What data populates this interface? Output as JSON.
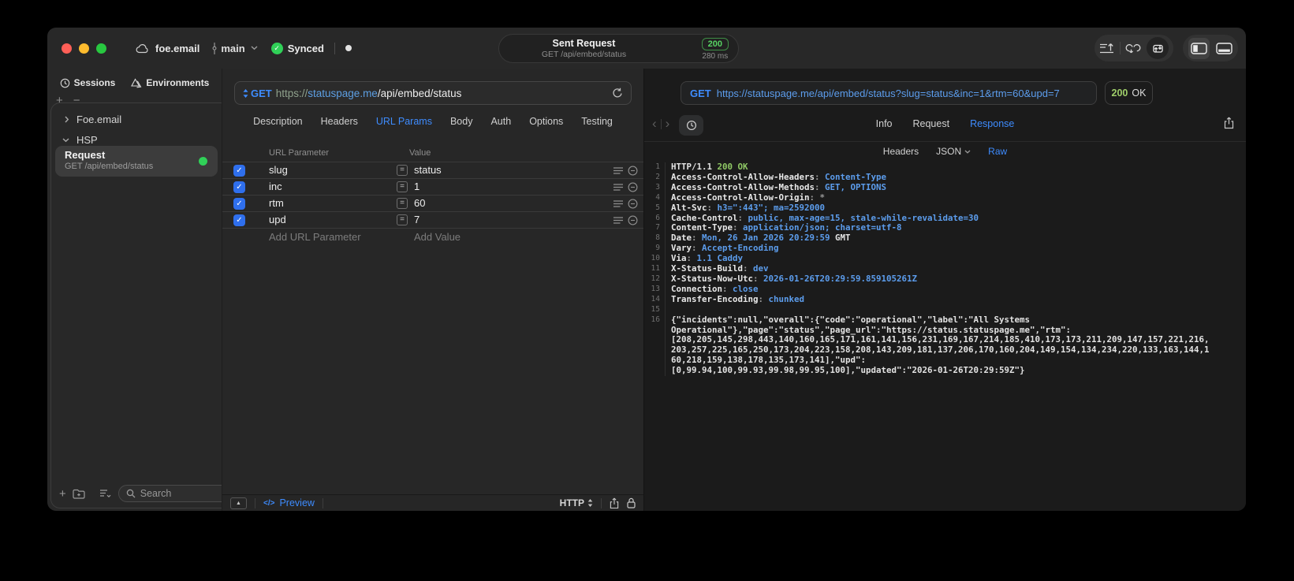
{
  "colors": {
    "accent_blue": "#3E8CFF",
    "status_green": "#30D158",
    "code_value_blue": "#5C9DED",
    "code_green": "#8FC865",
    "checkbox_blue": "#2F6FED",
    "traffic_red": "#FF5F57",
    "traffic_yellow": "#FEBC2E",
    "traffic_green": "#28C840"
  },
  "titlebar": {
    "project_name": "foe.email",
    "branch_name": "main",
    "sync_label": "Synced",
    "request_summary": {
      "title": "Sent Request",
      "subtitle": "GET /api/embed/status",
      "status_code": "200",
      "duration": "280 ms"
    }
  },
  "sidebar": {
    "tabs": [
      {
        "label": "Sessions"
      },
      {
        "label": "Environments"
      }
    ],
    "tree": [
      {
        "label": "Foe.email"
      },
      {
        "label": "HSP"
      }
    ],
    "selected_request": {
      "title": "Request",
      "subtitle": "GET /api/embed/status"
    },
    "search_placeholder": "Search"
  },
  "request_editor": {
    "method": "GET",
    "url_scheme": "https://",
    "url_host": "statuspage.me",
    "url_path": "/api/embed/status",
    "tabs": [
      "Description",
      "Headers",
      "URL Params",
      "Body",
      "Auth",
      "Options",
      "Testing"
    ],
    "active_tab": "URL Params",
    "params": {
      "columns": [
        "URL Parameter",
        "Value"
      ],
      "rows": [
        {
          "name": "slug",
          "value": "status",
          "enabled": true
        },
        {
          "name": "inc",
          "value": "1",
          "enabled": true
        },
        {
          "name": "rtm",
          "value": "60",
          "enabled": true
        },
        {
          "name": "upd",
          "value": "7",
          "enabled": true
        }
      ],
      "add_name_placeholder": "Add URL Parameter",
      "add_value_placeholder": "Add Value"
    },
    "footer": {
      "code_glyph": "</>",
      "preview_label": "Preview",
      "protocol": "HTTP"
    }
  },
  "response_viewer": {
    "method": "GET",
    "url": "https://statuspage.me/api/embed/status?slug=status&inc=1&rtm=60&upd=7",
    "status_code": "200",
    "status_text": "OK",
    "tabs": [
      "Info",
      "Request",
      "Response"
    ],
    "active_tab": "Response",
    "subtabs": [
      "Headers",
      "JSON",
      "Raw"
    ],
    "active_subtab": "Raw",
    "body_lines": [
      {
        "n": "1",
        "seg": [
          [
            "p",
            "HTTP/1.1 "
          ],
          [
            "g",
            "200 OK"
          ]
        ]
      },
      {
        "n": "2",
        "seg": [
          [
            "k",
            "Access-Control-Allow-Headers"
          ],
          [
            "c",
            ": "
          ],
          [
            "v",
            "Content-Type"
          ]
        ]
      },
      {
        "n": "3",
        "seg": [
          [
            "k",
            "Access-Control-Allow-Methods"
          ],
          [
            "c",
            ": "
          ],
          [
            "v",
            "GET, OPTIONS"
          ]
        ]
      },
      {
        "n": "4",
        "seg": [
          [
            "k",
            "Access-Control-Allow-Origin"
          ],
          [
            "c",
            ": "
          ],
          [
            "c",
            "*"
          ]
        ]
      },
      {
        "n": "5",
        "seg": [
          [
            "k",
            "Alt-Svc"
          ],
          [
            "c",
            ": "
          ],
          [
            "v",
            "h3=\":443\"; ma=2592000"
          ]
        ]
      },
      {
        "n": "6",
        "seg": [
          [
            "k",
            "Cache-Control"
          ],
          [
            "c",
            ": "
          ],
          [
            "v",
            "public, max-age=15, stale-while-revalidate=30"
          ]
        ]
      },
      {
        "n": "7",
        "seg": [
          [
            "k",
            "Content-Type"
          ],
          [
            "c",
            ": "
          ],
          [
            "v",
            "application/json; charset=utf-8"
          ]
        ]
      },
      {
        "n": "8",
        "seg": [
          [
            "k",
            "Date"
          ],
          [
            "c",
            ": "
          ],
          [
            "v",
            "Mon, 26 Jan 2026 20:29:59 "
          ],
          [
            "p",
            "GMT"
          ]
        ]
      },
      {
        "n": "9",
        "seg": [
          [
            "k",
            "Vary"
          ],
          [
            "c",
            ": "
          ],
          [
            "v",
            "Accept-Encoding"
          ]
        ]
      },
      {
        "n": "10",
        "seg": [
          [
            "k",
            "Via"
          ],
          [
            "c",
            ": "
          ],
          [
            "v",
            "1.1 Caddy"
          ]
        ]
      },
      {
        "n": "11",
        "seg": [
          [
            "k",
            "X-Status-Build"
          ],
          [
            "c",
            ": "
          ],
          [
            "v",
            "dev"
          ]
        ]
      },
      {
        "n": "12",
        "seg": [
          [
            "k",
            "X-Status-Now-Utc"
          ],
          [
            "c",
            ": "
          ],
          [
            "v",
            "2026-01-26T20:29:59.859105261Z"
          ]
        ]
      },
      {
        "n": "13",
        "seg": [
          [
            "k",
            "Connection"
          ],
          [
            "c",
            ": "
          ],
          [
            "v",
            "close"
          ]
        ]
      },
      {
        "n": "14",
        "seg": [
          [
            "k",
            "Transfer-Encoding"
          ],
          [
            "c",
            ": "
          ],
          [
            "v",
            "chunked"
          ]
        ]
      },
      {
        "n": "15",
        "seg": []
      },
      {
        "n": "16",
        "seg": [
          [
            "j",
            "{\"incidents\":null,\"overall\":{\"code\":\"operational\",\"label\":\"All Systems"
          ]
        ]
      },
      {
        "n": "",
        "seg": [
          [
            "j",
            "Operational\"},\"page\":\"status\",\"page_url\":\"https://status.statuspage.me\",\"rtm\":"
          ]
        ]
      },
      {
        "n": "",
        "seg": [
          [
            "j",
            "[208,205,145,298,443,140,160,165,171,161,141,156,231,169,167,214,185,410,173,173,211,209,147,157,221,216,"
          ]
        ]
      },
      {
        "n": "",
        "seg": [
          [
            "j",
            "203,257,225,165,250,173,204,223,158,208,143,209,181,137,206,170,160,204,149,154,134,234,220,133,163,144,1"
          ]
        ]
      },
      {
        "n": "",
        "seg": [
          [
            "j",
            "60,218,159,138,178,135,173,141],\"upd\":"
          ]
        ]
      },
      {
        "n": "",
        "seg": [
          [
            "j",
            "[0,99.94,100,99.93,99.98,99.95,100],\"updated\":\"2026-01-26T20:29:59Z\"}"
          ]
        ]
      }
    ]
  }
}
